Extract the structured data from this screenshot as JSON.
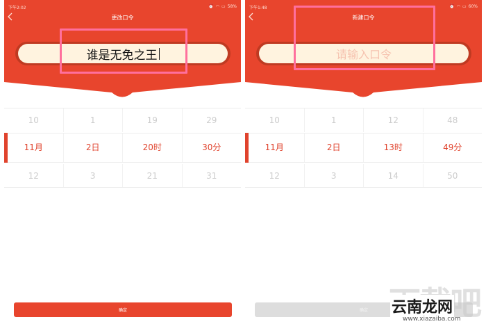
{
  "colors": {
    "header_red": "#e8452d",
    "accent_red": "#e0432d",
    "pill_fill": "#fff3df",
    "highlight_pink": "#ff6f9d",
    "disabled_gray": "#dddddd"
  },
  "left": {
    "status_time": "下午2:02",
    "status_battery": "58%",
    "title": "更改口令",
    "input_value": "谁是无免之王",
    "picker": {
      "top": [
        "10",
        "1",
        "19",
        "29"
      ],
      "selected": [
        "11月",
        "2日",
        "20时",
        "30分"
      ],
      "bottom": [
        "12",
        "3",
        "21",
        "31"
      ]
    },
    "confirm_label": "确定"
  },
  "right": {
    "status_time": "下午1:48",
    "status_battery": "60%",
    "title": "新建口令",
    "input_placeholder": "请输入口令",
    "picker": {
      "top": [
        "10",
        "1",
        "12",
        "48"
      ],
      "selected": [
        "11月",
        "2日",
        "13时",
        "49分"
      ],
      "bottom": [
        "12",
        "3",
        "14",
        "50"
      ]
    },
    "confirm_label": "确定"
  },
  "watermark": {
    "big": "下载吧",
    "brand": "云南龙网",
    "url": "www.xiazaiba.com"
  }
}
